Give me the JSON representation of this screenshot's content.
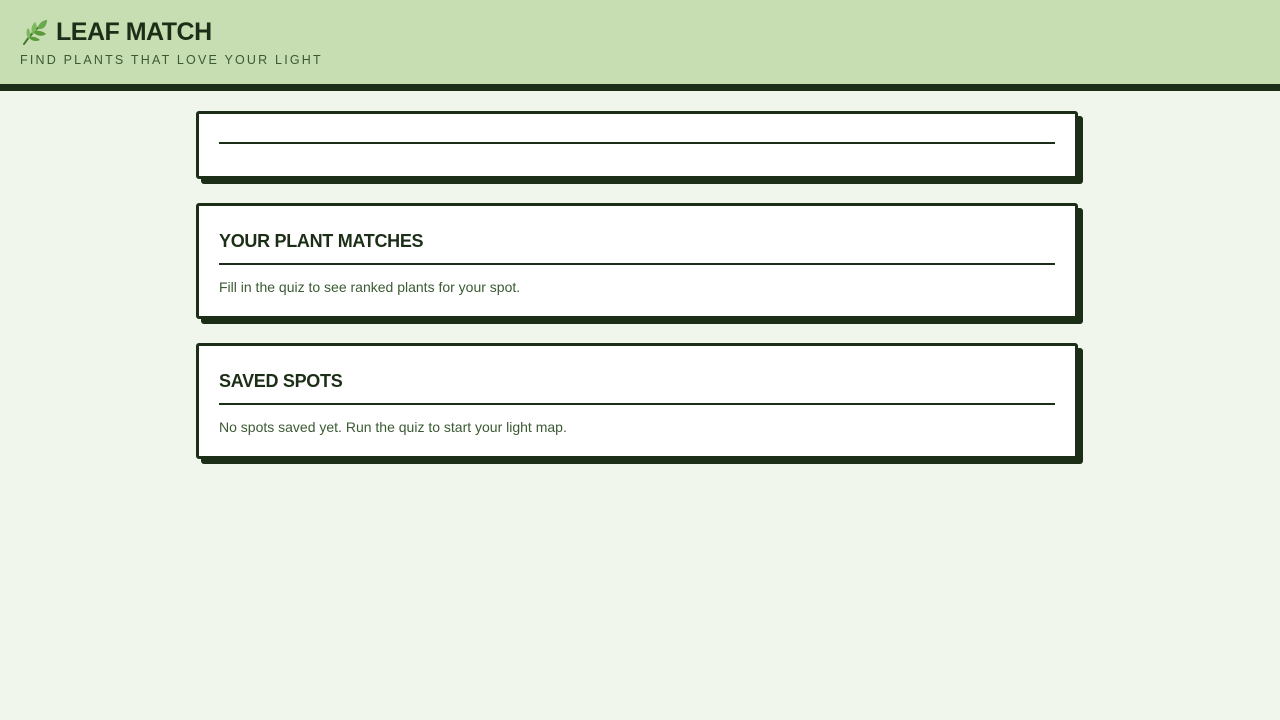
{
  "header": {
    "icon": "leaf-icon",
    "title": "LEAF MATCH",
    "tagline": "FIND PLANTS THAT LOVE YOUR LIGHT"
  },
  "quiz_card": {},
  "matches_card": {
    "title": "YOUR PLANT MATCHES",
    "message": "Fill in the quiz to see ranked plants for your spot."
  },
  "saved_card": {
    "title": "SAVED SPOTS",
    "message": "No spots saved yet. Run the quiz to start your light map."
  },
  "colors": {
    "page_background": "#f0f6ec",
    "header_background": "#c7ddb2",
    "ink": "#1c2e17",
    "muted_text": "#3b5a33",
    "leaf_green": "#5a9a3a"
  }
}
